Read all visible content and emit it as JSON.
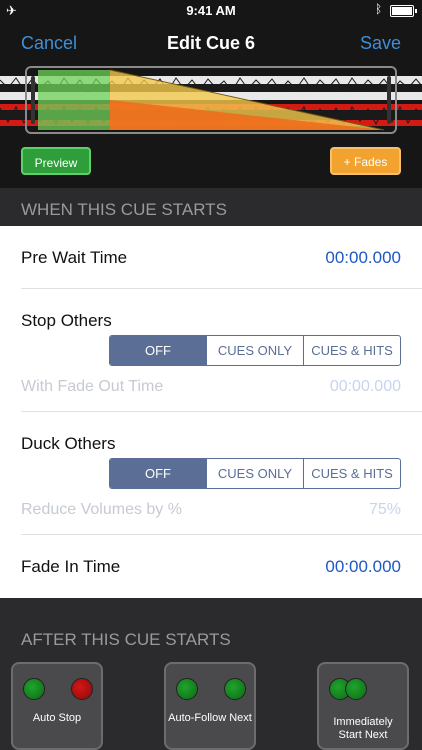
{
  "status_bar": {
    "time": "9:41 AM"
  },
  "nav": {
    "cancel": "Cancel",
    "title": "Edit Cue 6",
    "save": "Save"
  },
  "waveform": {
    "preview_label": "Preview",
    "fades_label": "+ Fades"
  },
  "section_when": {
    "header": "WHEN THIS CUE STARTS"
  },
  "pre_wait": {
    "label": "Pre Wait Time",
    "value": "00:00.000"
  },
  "stop_others": {
    "label": "Stop Others",
    "options": [
      "OFF",
      "CUES ONLY",
      "CUES & HITS"
    ],
    "selected": "OFF",
    "fade_label": "With Fade Out Time",
    "fade_value": "00:00.000"
  },
  "duck_others": {
    "label": "Duck Others",
    "options": [
      "OFF",
      "CUES ONLY",
      "CUES & HITS"
    ],
    "selected": "OFF",
    "reduce_label": "Reduce Volumes by %",
    "reduce_value": "75%"
  },
  "fade_in": {
    "label": "Fade In Time",
    "value": "00:00.000"
  },
  "section_after": {
    "header": "AFTER THIS CUE STARTS"
  },
  "after_options": [
    {
      "label": "Auto Stop"
    },
    {
      "label": "Auto-Follow Next"
    },
    {
      "label_line1": "Immediately",
      "label_line2": "Start Next"
    }
  ],
  "colors": {
    "accent": "#3f8fd8",
    "value_blue": "#1f58c4",
    "segment": "#5a6e96",
    "preview_green": "#2e9e3a",
    "fades_orange": "#f2a22e"
  }
}
